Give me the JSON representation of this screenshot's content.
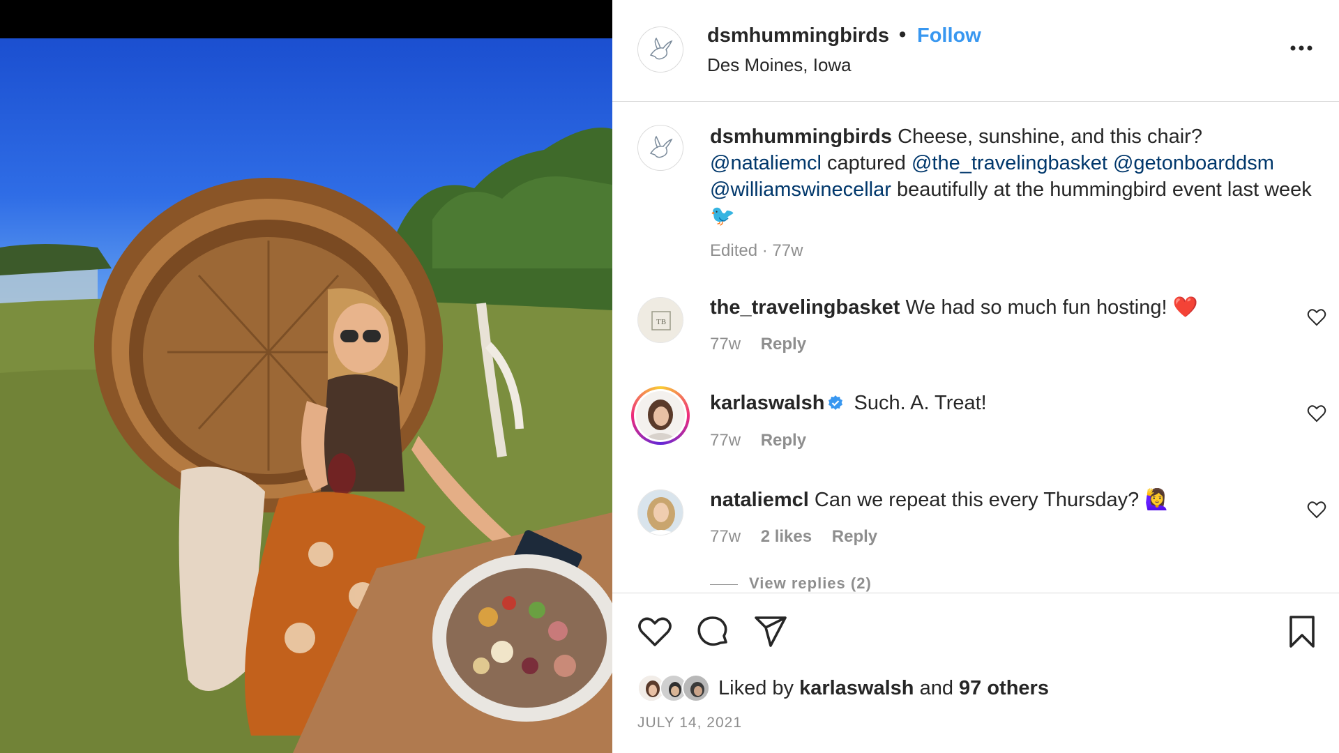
{
  "post": {
    "author": "dsmhummingbirds",
    "follow_label": "Follow",
    "separator": "•",
    "location": "Des Moines, Iowa",
    "more_icon": "more-horizontal-icon"
  },
  "caption": {
    "author": "dsmhummingbirds",
    "text_1": " Cheese, sunshine, and this chair? ",
    "mention_1": "@nataliemcl",
    "text_2": " captured ",
    "mention_2": "@the_travelingbasket",
    "text_3": " ",
    "mention_3": "@getonboarddsm",
    "text_4": " ",
    "mention_4": "@williamswinecellar",
    "text_5": " beautifully at the hummingbird event last week ",
    "emoji": "🐦",
    "meta": "Edited · 77w"
  },
  "comments": [
    {
      "user": "the_travelingbasket",
      "text": " We had so much fun hosting! ",
      "emoji": "❤️",
      "age": "77w",
      "likes": "",
      "reply_label": "Reply"
    },
    {
      "user": "karlaswalsh",
      "text": " Such. A. Treat!",
      "emoji": "",
      "age": "77w",
      "likes": "",
      "reply_label": "Reply",
      "verified": true
    },
    {
      "user": "nataliemcl",
      "text": " Can we repeat this every Thursday? ",
      "emoji": "🙋‍♀️",
      "age": "77w",
      "likes": "2 likes",
      "reply_label": "Reply"
    }
  ],
  "view_replies": "View replies (2)",
  "actions": {
    "icons": [
      "heart-icon",
      "comment-icon",
      "share-icon",
      "bookmark-icon"
    ]
  },
  "likes": {
    "prefix": "Liked by ",
    "user": "karlaswalsh",
    "middle": " and ",
    "others": "97 others"
  },
  "date": "JULY 14, 2021",
  "colors": {
    "follow": "#3897f0",
    "mention": "#00376b",
    "meta": "#8e8e8e",
    "verified": "#3897f0",
    "red_heart": "#e0245e"
  }
}
